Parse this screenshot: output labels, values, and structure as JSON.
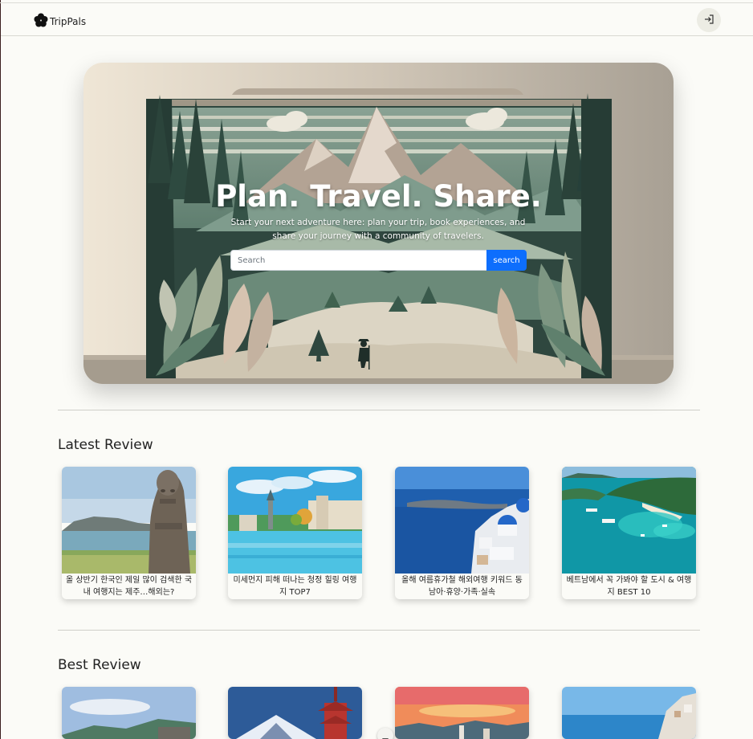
{
  "navbar": {
    "brand": "TripPals",
    "logo_icon": "flower-icon",
    "login_icon": "sign-in-icon"
  },
  "hero": {
    "title": "Plan. Travel. Share.",
    "subtitle": "Start your next adventure here: plan your trip, book experiences, and share your journey with a community of travelers.",
    "search_placeholder": "Search",
    "search_button": "search"
  },
  "latest": {
    "title": "Latest Review",
    "cards": [
      {
        "caption": "올 상반기 한국인 제일 많이 검색한 국내 여행지는 제주…해외는?"
      },
      {
        "caption": "미세먼지 피해 떠나는 청정 힐링 여행지 TOP7"
      },
      {
        "caption": "올해 여름휴가철 해외여행 키워드 동남아·휴양·가족·실속"
      },
      {
        "caption": "베트남에서 꼭 가봐야 할 도시 & 여행지 BEST 10"
      }
    ]
  },
  "best": {
    "title": "Best Review"
  },
  "colors": {
    "accent": "#0d6efd",
    "background": "#fbfbf7"
  }
}
